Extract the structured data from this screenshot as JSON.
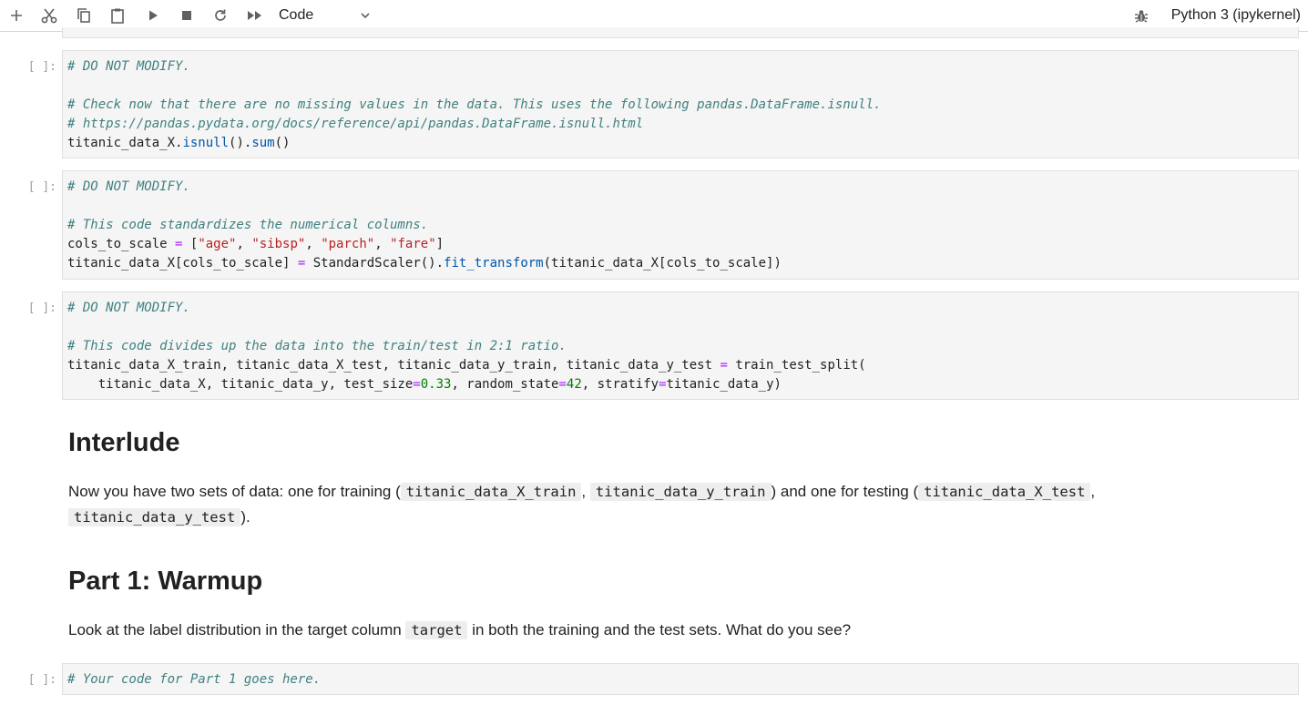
{
  "toolbar": {
    "buttons": [
      {
        "name": "add-cell-button",
        "icon": "plus-icon"
      },
      {
        "name": "cut-button",
        "icon": "scissors-icon"
      },
      {
        "name": "copy-button",
        "icon": "copy-icon"
      },
      {
        "name": "paste-button",
        "icon": "clipboard-icon"
      },
      {
        "name": "run-button",
        "icon": "play-icon"
      },
      {
        "name": "stop-button",
        "icon": "stop-icon"
      },
      {
        "name": "restart-button",
        "icon": "refresh-icon"
      },
      {
        "name": "restart-run-all-button",
        "icon": "fast-forward-icon"
      }
    ],
    "cell_type": "Code",
    "kernel_icon": "bug-icon",
    "kernel_name": "Python 3 (ipykernel)"
  },
  "cells": [
    {
      "prompt": "[ ]:",
      "lines": [
        "# DO NOT MODIFY.",
        "",
        "# Check now that there are no missing values in the data. This uses the following pandas.DataFrame.isnull.",
        "# https://pandas.pydata.org/docs/reference/api/pandas.DataFrame.isnull.html",
        "titanic_data_X.isnull().sum()"
      ]
    },
    {
      "prompt": "[ ]:",
      "lines": [
        "# DO NOT MODIFY.",
        "",
        "# This code standardizes the numerical columns.",
        "cols_to_scale = [\"age\", \"sibsp\", \"parch\", \"fare\"]",
        "titanic_data_X[cols_to_scale] = StandardScaler().fit_transform(titanic_data_X[cols_to_scale])"
      ]
    },
    {
      "prompt": "[ ]:",
      "lines": [
        "# DO NOT MODIFY.",
        "",
        "# This code divides up the data into the train/test in 2:1 ratio.",
        "titanic_data_X_train, titanic_data_X_test, titanic_data_y_train, titanic_data_y_test = train_test_split(",
        "    titanic_data_X, titanic_data_y, test_size=0.33, random_state=42, stratify=titanic_data_y)"
      ]
    },
    {
      "prompt": "[ ]:",
      "lines": [
        "# Your code for Part 1 goes here."
      ]
    }
  ],
  "markdown": {
    "interlude_heading": "Interlude",
    "interlude_text_1": "Now you have two sets of data: one for training (",
    "interlude_code_1": "titanic_data_X_train",
    "interlude_text_2": ",",
    "interlude_code_2": "titanic_data_y_train",
    "interlude_text_3": ") and one for testing (",
    "interlude_code_3": "titanic_data_X_test",
    "interlude_text_4": ",",
    "interlude_code_4": "titanic_data_y_test",
    "interlude_text_5": ").",
    "part1_heading": "Part 1: Warmup",
    "part1_text_1": "Look at the label distribution in the target column",
    "part1_code_1": "target",
    "part1_text_2": "in both the training and the test sets. What do you see?"
  }
}
